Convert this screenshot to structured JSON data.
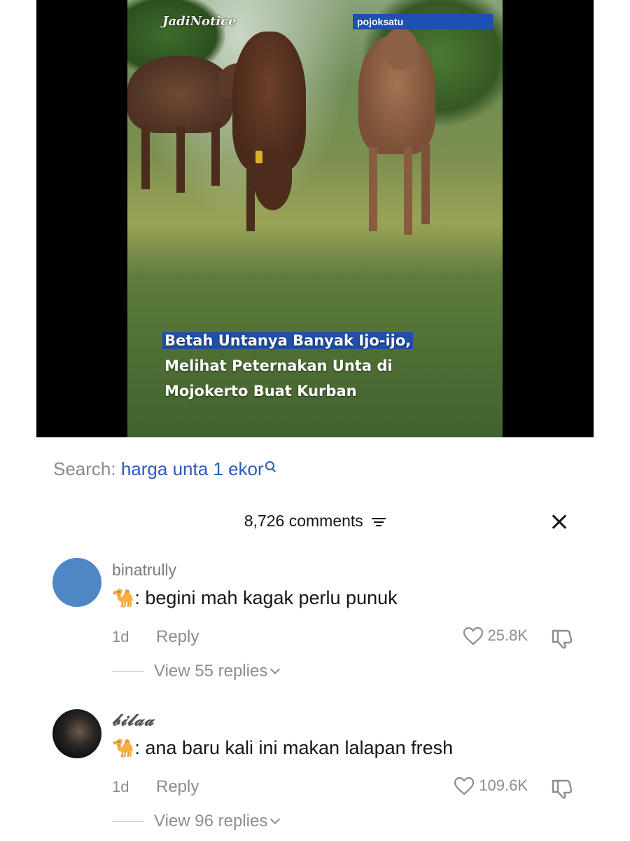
{
  "video": {
    "watermark_left": "JadiNotice",
    "watermark_right": "pojoksatu",
    "caption_lines": [
      "Betah Untanya Banyak Ijo-ijo,",
      "Melihat Peternakan Unta di",
      "Mojokerto Buat Kurban"
    ]
  },
  "search": {
    "prefix": "Search:",
    "term": "harga unta 1 ekor"
  },
  "comments_header": {
    "count_label": "8,726 comments"
  },
  "comments": [
    {
      "username": "binatrully",
      "emoji": "🐪",
      "text": ": begini mah kagak perlu punuk",
      "time": "1d",
      "reply_label": "Reply",
      "likes": "25.8K",
      "replies_label": "View 55 replies"
    },
    {
      "username": "𝓫𝓲𝓵𝓪𝓪",
      "emoji": "🐪",
      "text": ": ana baru kali ini makan lalapan fresh",
      "time": "1d",
      "reply_label": "Reply",
      "likes": "109.6K",
      "replies_label": "View 96 replies"
    }
  ],
  "colors": {
    "search_term": "#2b59c3",
    "caption_highlight": "#1f4fa8",
    "avatar_blue": "#4f86c6",
    "muted_text": "#8d8d8d"
  }
}
